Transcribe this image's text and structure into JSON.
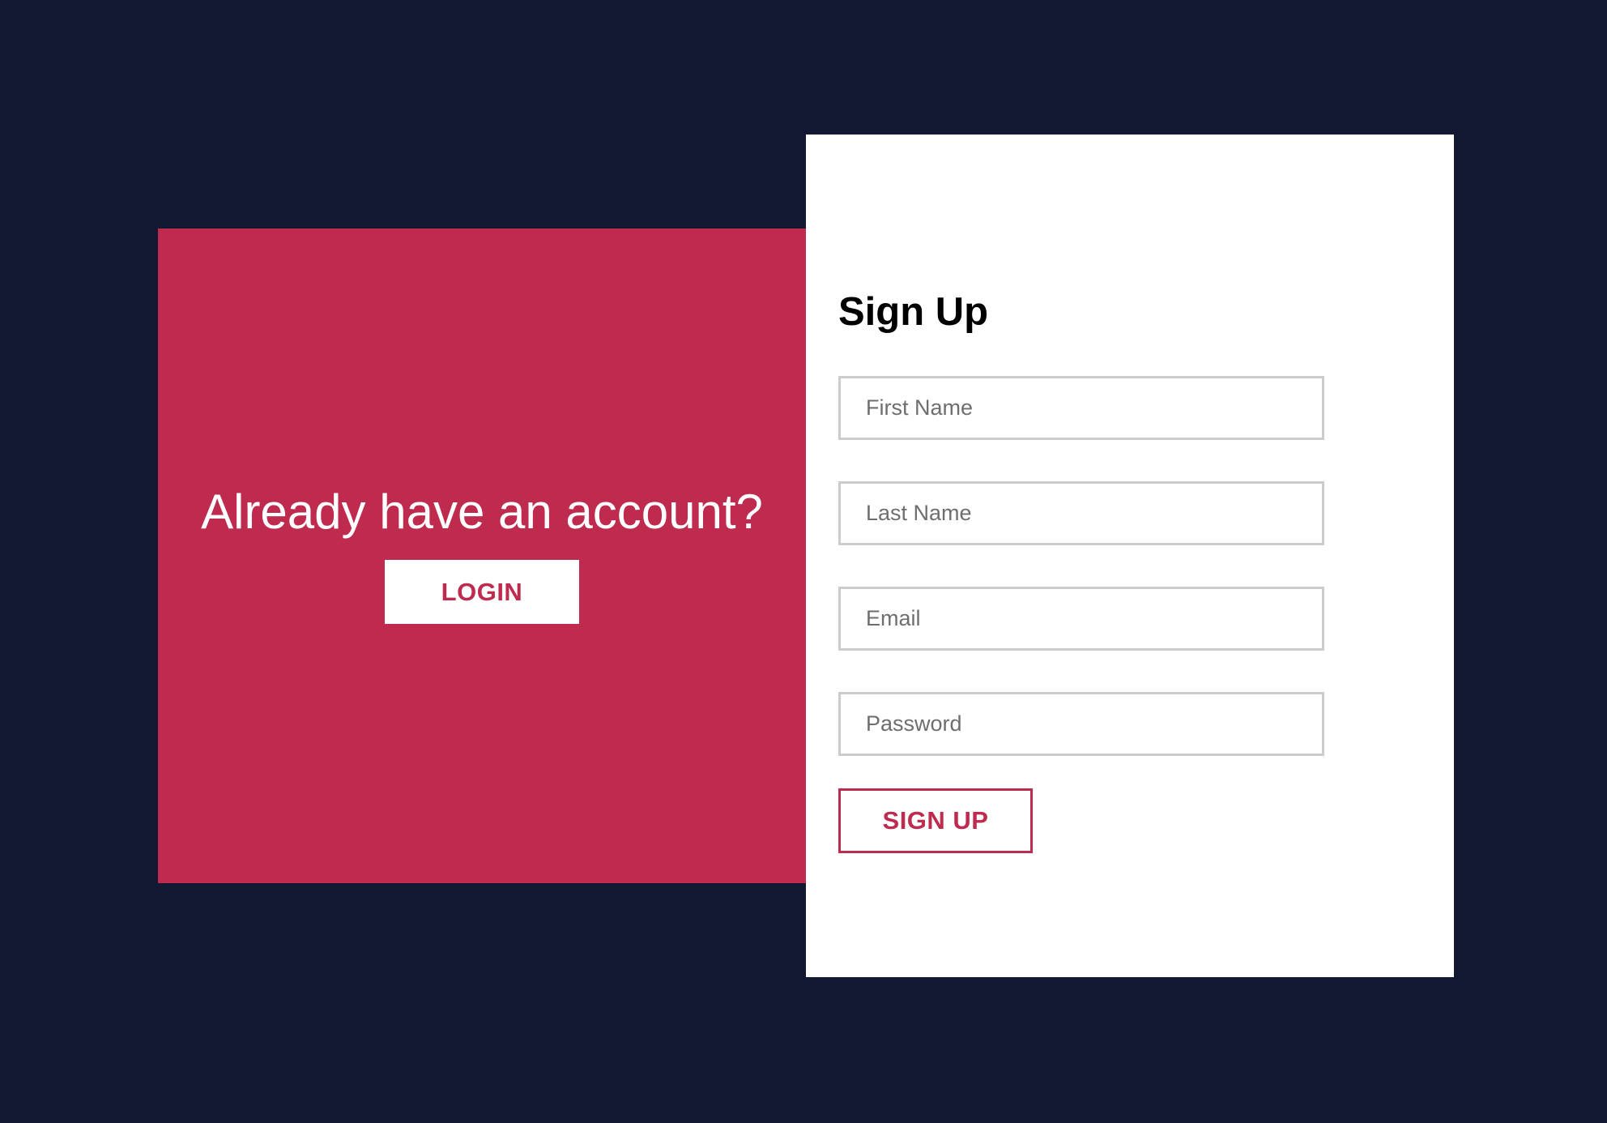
{
  "theme": {
    "background": "#131832",
    "accent": "#be2b4e",
    "panel": "#ffffff",
    "field_border": "#cccccc"
  },
  "left_panel": {
    "title": "Already have an account?",
    "login_label": "LOGIN"
  },
  "signup": {
    "title": "Sign Up",
    "fields": [
      {
        "placeholder": "First Name",
        "value": ""
      },
      {
        "placeholder": "Last Name",
        "value": ""
      },
      {
        "placeholder": "Email",
        "value": ""
      },
      {
        "placeholder": "Password",
        "value": ""
      }
    ],
    "submit_label": "SIGN UP"
  }
}
